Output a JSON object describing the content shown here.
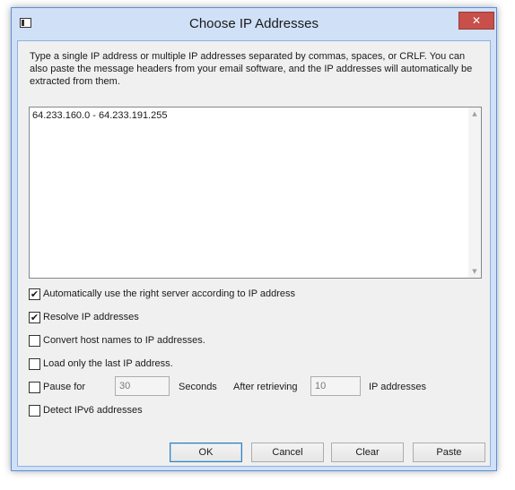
{
  "window": {
    "title": "Choose IP Addresses",
    "close_glyph": "✕"
  },
  "instructions": "Type a single IP address or multiple IP addresses separated by commas, spaces, or CRLF. You can also paste the message headers from your email software, and the IP addresses will automatically be extracted from them.",
  "ip_input": {
    "value": "64.233.160.0 - 64.233.191.255"
  },
  "options": {
    "auto_server": {
      "label": "Automatically use the right server according to IP address",
      "checked": true
    },
    "resolve_ip": {
      "label": "Resolve IP addresses",
      "checked": true
    },
    "convert_hosts": {
      "label": "Convert host names to IP addresses.",
      "checked": false
    },
    "load_last": {
      "label": "Load only the last IP address.",
      "checked": false
    },
    "pause": {
      "label": "Pause for",
      "checked": false
    },
    "detect_ipv6": {
      "label": "Detect IPv6 addresses",
      "checked": false
    }
  },
  "pause_row": {
    "seconds_value": "30",
    "seconds_label": "Seconds",
    "after_label": "After retrieving",
    "count_value": "10",
    "count_label": "IP addresses"
  },
  "buttons": {
    "ok": "OK",
    "cancel": "Cancel",
    "clear": "Clear",
    "paste": "Paste"
  },
  "icons": {
    "check_glyph": "✔",
    "scroll_up": "▲",
    "scroll_down": "▼"
  }
}
